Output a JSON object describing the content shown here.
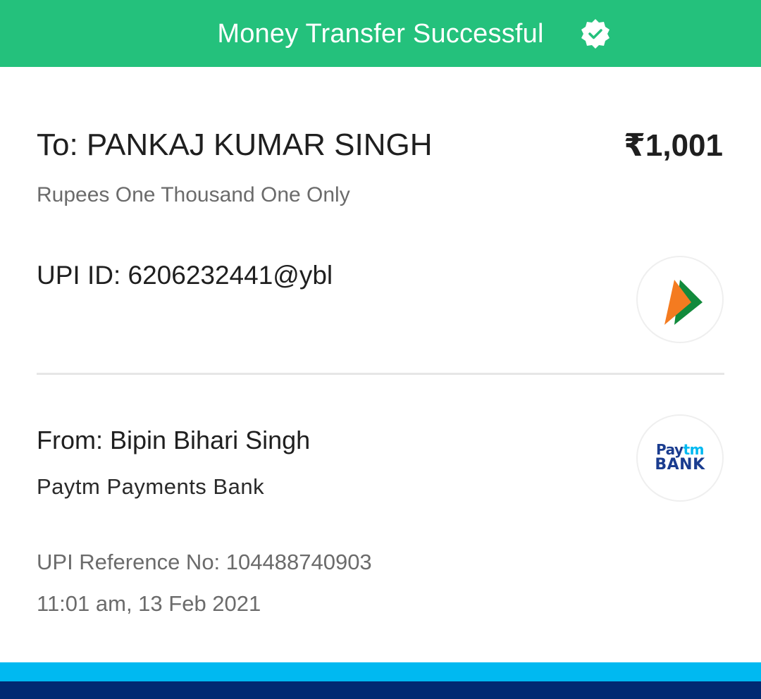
{
  "header": {
    "title": "Money Transfer Successful",
    "status_icon": "verified-check-badge-icon",
    "background_color": "#24c17c"
  },
  "recipient": {
    "to_label": "To: PANKAJ KUMAR SINGH",
    "amount": "₹1,001",
    "amount_in_words": "Rupees One Thousand One Only",
    "upi_id": "UPI ID: 6206232441@ybl",
    "logo_icon": "upi-logo-icon"
  },
  "sender": {
    "from_label": "From: Bipin Bihari Singh",
    "bank_name": "Paytm Payments Bank",
    "logo_icon": "paytm-bank-logo-icon",
    "logo_text_1a": "Pay",
    "logo_text_1b": "tm",
    "logo_text_2": "BANK"
  },
  "transaction": {
    "reference": "UPI Reference No: 104488740903",
    "timestamp": "11:01 am, 13 Feb 2021"
  },
  "colors": {
    "accent_light_blue": "#00b9f1",
    "accent_dark_blue": "#012a72",
    "text_primary": "#1f1f1f",
    "text_secondary": "#6b6b6b"
  }
}
